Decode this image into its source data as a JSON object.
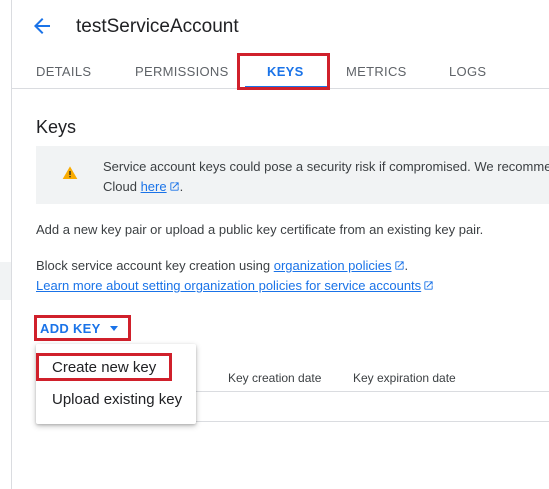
{
  "header": {
    "title": "testServiceAccount"
  },
  "tabs": [
    {
      "label": "DETAILS"
    },
    {
      "label": "PERMISSIONS"
    },
    {
      "label": "KEYS"
    },
    {
      "label": "METRICS"
    },
    {
      "label": "LOGS"
    }
  ],
  "section": {
    "title": "Keys"
  },
  "warning": {
    "line1": "Service account keys could pose a security risk if compromised. We recomme",
    "line2_prefix": "Cloud ",
    "link": "here",
    "line2_suffix": "."
  },
  "info": {
    "text": "Add a new key pair or upload a public key certificate from an existing key pair."
  },
  "policy": {
    "prefix": "Block service account key creation using ",
    "link": "organization policies",
    "suffix": ".",
    "learn_more": "Learn more about setting organization policies for service accounts"
  },
  "add_key": {
    "label": "ADD KEY"
  },
  "table": {
    "columns": [
      "Key creation date",
      "Key expiration date"
    ]
  },
  "menu": {
    "items": [
      "Create new key",
      "Upload existing key"
    ]
  },
  "colors": {
    "accent": "#1a73e8",
    "highlight": "#d0202b",
    "warning": "#f9ab00"
  }
}
